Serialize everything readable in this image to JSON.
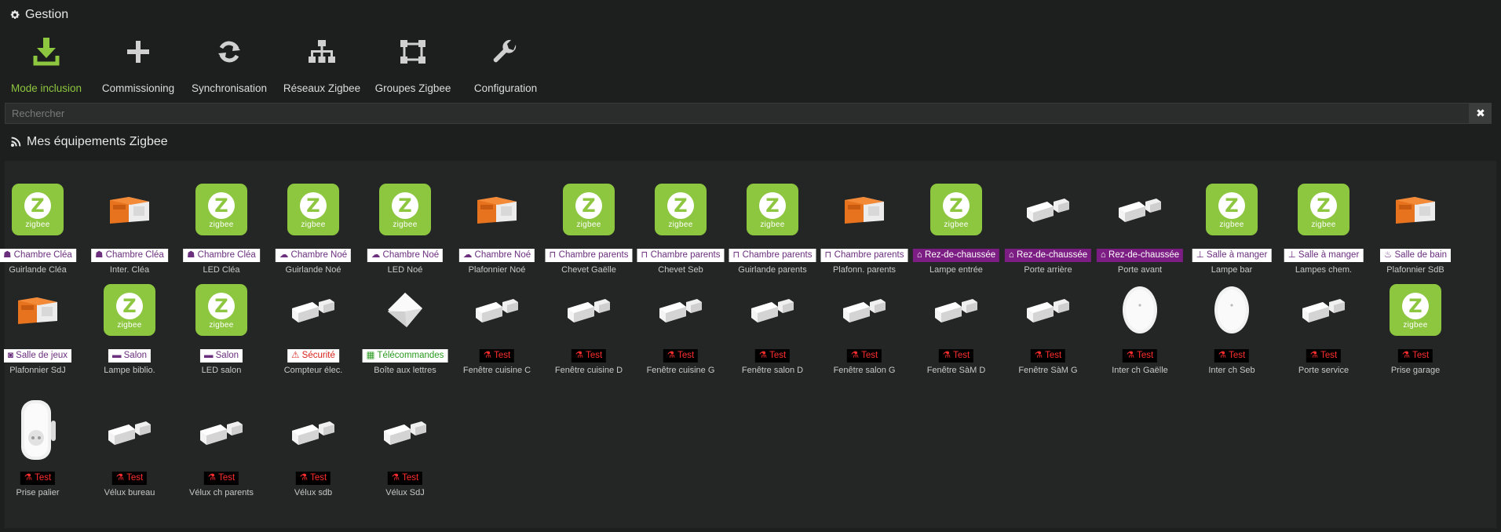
{
  "gestion": {
    "title": "Gestion",
    "actions": [
      {
        "label": "Mode inclusion",
        "icon": "download-icon",
        "active": true
      },
      {
        "label": "Commissioning",
        "icon": "plus-icon"
      },
      {
        "label": "Synchronisation",
        "icon": "sync-icon"
      },
      {
        "label": "Réseaux Zigbee",
        "icon": "network-icon"
      },
      {
        "label": "Groupes Zigbee",
        "icon": "group-icon"
      },
      {
        "label": "Configuration",
        "icon": "wrench-icon"
      }
    ]
  },
  "search": {
    "placeholder": "Rechercher",
    "value": "",
    "clear_label": "✖"
  },
  "equipments": {
    "title": "Mes équipements Zigbee",
    "items": [
      {
        "name": "Guirlande Cléa",
        "room": "Chambre Cléa",
        "style": "white",
        "img": "zigbee",
        "room_icon": "child-icon"
      },
      {
        "name": "Inter. Cléa",
        "room": "Chambre Cléa",
        "style": "white",
        "img": "module",
        "room_icon": "child-icon"
      },
      {
        "name": "LED Cléa",
        "room": "Chambre Cléa",
        "style": "white",
        "img": "zigbee",
        "room_icon": "child-icon"
      },
      {
        "name": "Guirlande Noé",
        "room": "Chambre Noé",
        "style": "white",
        "img": "zigbee",
        "room_icon": "cloud-icon"
      },
      {
        "name": "LED Noé",
        "room": "Chambre Noé",
        "style": "white",
        "img": "zigbee",
        "room_icon": "cloud-icon"
      },
      {
        "name": "Plafonnier Noé",
        "room": "Chambre Noé",
        "style": "white",
        "img": "module",
        "room_icon": "cloud-icon"
      },
      {
        "name": "Chevet Gaëlle",
        "room": "Chambre parents",
        "style": "white",
        "img": "zigbee",
        "room_icon": "bed-icon"
      },
      {
        "name": "Chevet Seb",
        "room": "Chambre parents",
        "style": "white",
        "img": "zigbee",
        "room_icon": "bed-icon"
      },
      {
        "name": "Guirlande parents",
        "room": "Chambre parents",
        "style": "white",
        "img": "zigbee",
        "room_icon": "bed-icon"
      },
      {
        "name": "Plafonn. parents",
        "room": "Chambre parents",
        "style": "white",
        "img": "module",
        "room_icon": "bed-icon"
      },
      {
        "name": "Lampe entrée",
        "room": "Rez-de-chaussée",
        "style": "purple",
        "img": "zigbee",
        "room_icon": "home-icon"
      },
      {
        "name": "Porte arrière",
        "room": "Rez-de-chaussée",
        "style": "purple",
        "img": "door-sensor",
        "room_icon": "home-icon"
      },
      {
        "name": "Porte avant",
        "room": "Rez-de-chaussée",
        "style": "purple",
        "img": "door-sensor",
        "room_icon": "home-icon"
      },
      {
        "name": "Lampe bar",
        "room": "Salle à manger",
        "style": "white",
        "img": "zigbee",
        "room_icon": "table-icon"
      },
      {
        "name": "Lampes chem.",
        "room": "Salle à manger",
        "style": "white",
        "img": "zigbee",
        "room_icon": "table-icon"
      },
      {
        "name": "Plafonnier SdB",
        "room": "Salle de bain",
        "style": "white",
        "img": "module",
        "room_icon": "bath-icon"
      },
      {
        "name": "Plafonnier SdJ",
        "room": "Salle de jeux",
        "style": "white",
        "img": "module",
        "room_icon": "gamepad-icon"
      },
      {
        "name": "Lampe biblio.",
        "room": "Salon",
        "style": "white",
        "img": "zigbee",
        "room_icon": "sofa-icon"
      },
      {
        "name": "LED salon",
        "room": "Salon",
        "style": "white",
        "img": "zigbee",
        "room_icon": "sofa-icon"
      },
      {
        "name": "Compteur élec.",
        "room": "Sécurité",
        "style": "red",
        "img": "door-sensor",
        "room_icon": "warning-icon"
      },
      {
        "name": "Boîte aux lettres",
        "room": "Télécommandes",
        "style": "green",
        "img": "square-sensor",
        "room_icon": "grid-icon"
      },
      {
        "name": "Fenêtre cuisine C",
        "room": "Test",
        "style": "black",
        "img": "door-sensor",
        "room_icon": "flask-icon"
      },
      {
        "name": "Fenêtre cuisine D",
        "room": "Test",
        "style": "black",
        "img": "door-sensor",
        "room_icon": "flask-icon"
      },
      {
        "name": "Fenêtre cuisine G",
        "room": "Test",
        "style": "black",
        "img": "door-sensor",
        "room_icon": "flask-icon"
      },
      {
        "name": "Fenêtre salon D",
        "room": "Test",
        "style": "black",
        "img": "door-sensor",
        "room_icon": "flask-icon"
      },
      {
        "name": "Fenêtre salon G",
        "room": "Test",
        "style": "black",
        "img": "door-sensor",
        "room_icon": "flask-icon"
      },
      {
        "name": "Fenêtre SàM D",
        "room": "Test",
        "style": "black",
        "img": "door-sensor",
        "room_icon": "flask-icon"
      },
      {
        "name": "Fenêtre SàM G",
        "room": "Test",
        "style": "black",
        "img": "door-sensor",
        "room_icon": "flask-icon"
      },
      {
        "name": "Inter ch Gaëlle",
        "room": "Test",
        "style": "black",
        "img": "round-button",
        "room_icon": "flask-icon"
      },
      {
        "name": "Inter ch Seb",
        "room": "Test",
        "style": "black",
        "img": "round-button",
        "room_icon": "flask-icon"
      },
      {
        "name": "Porte service",
        "room": "Test",
        "style": "black",
        "img": "door-sensor",
        "room_icon": "flask-icon"
      },
      {
        "name": "Prise garage",
        "room": "Test",
        "style": "black",
        "img": "zigbee",
        "room_icon": "flask-icon"
      },
      {
        "name": "Prise palier",
        "room": "Test",
        "style": "black",
        "img": "plug",
        "room_icon": "flask-icon"
      },
      {
        "name": "Vélux bureau",
        "room": "Test",
        "style": "black",
        "img": "door-sensor",
        "room_icon": "flask-icon"
      },
      {
        "name": "Vélux ch parents",
        "room": "Test",
        "style": "black",
        "img": "door-sensor",
        "room_icon": "flask-icon"
      },
      {
        "name": "Vélux sdb",
        "room": "Test",
        "style": "black",
        "img": "door-sensor",
        "room_icon": "flask-icon"
      },
      {
        "name": "Vélux SdJ",
        "room": "Test",
        "style": "black",
        "img": "door-sensor",
        "room_icon": "flask-icon"
      }
    ]
  },
  "zigbee_logo_text": "zigbee",
  "colors": {
    "accent": "#8dc63f",
    "purple": "#7b1d82",
    "test_red": "#ff2e2e"
  }
}
